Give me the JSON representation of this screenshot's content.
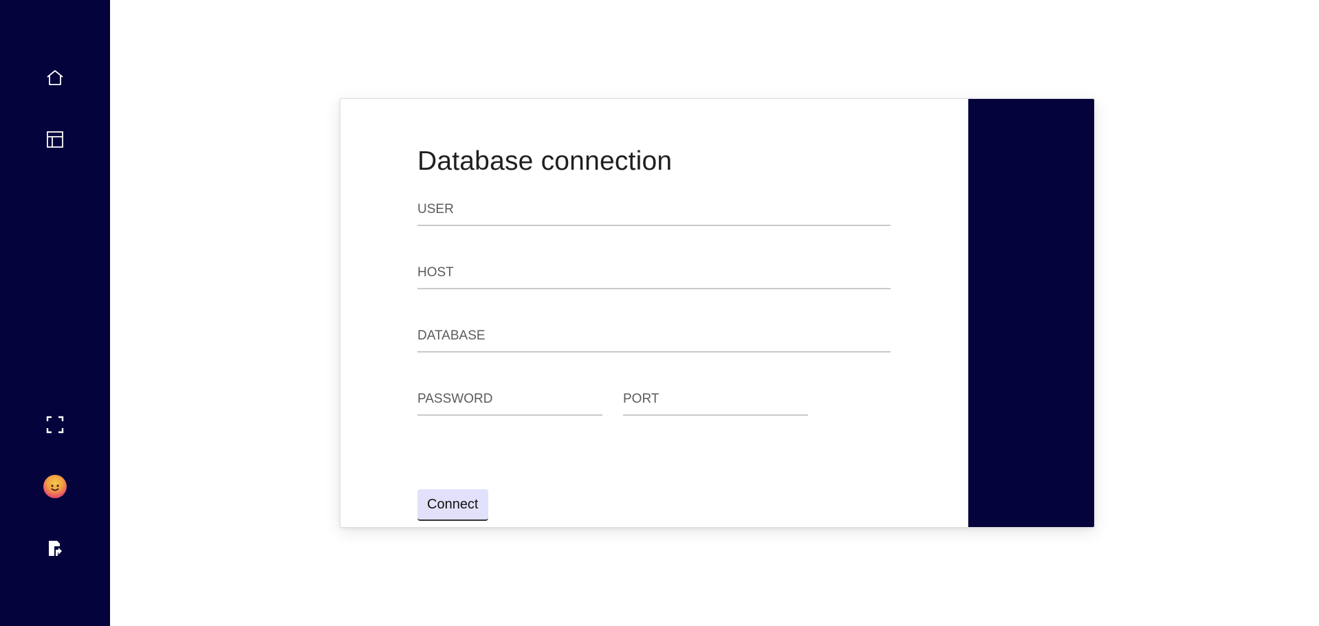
{
  "sidebar": {
    "items": [
      {
        "icon": "home-icon"
      },
      {
        "icon": "layout-icon"
      }
    ],
    "bottom_items": [
      {
        "icon": "fullscreen-icon"
      },
      {
        "icon": "avatar"
      },
      {
        "icon": "logout-icon"
      }
    ],
    "background": "#04033c"
  },
  "form": {
    "title": "Database connection",
    "fields": {
      "user": {
        "value": "",
        "placeholder": "USER"
      },
      "host": {
        "value": "",
        "placeholder": "HOST"
      },
      "database": {
        "value": "",
        "placeholder": "DATABASE"
      },
      "password": {
        "value": "",
        "placeholder": "PASSWORD"
      },
      "port": {
        "value": "",
        "placeholder": "PORT"
      }
    },
    "connect_label": "Connect",
    "button_color": "#e2e1fb"
  },
  "accent_color": "#04033c"
}
